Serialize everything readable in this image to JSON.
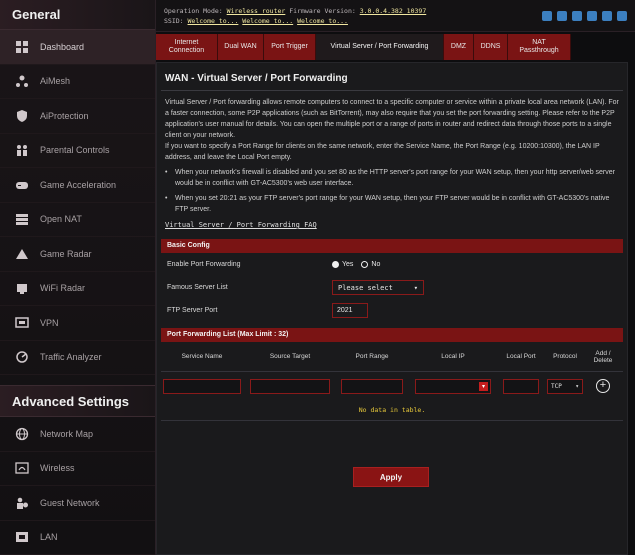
{
  "sidebar": {
    "general_heading": "General",
    "general_items": [
      {
        "label": "Dashboard",
        "icon": "dashboard-icon"
      },
      {
        "label": "AiMesh",
        "icon": "mesh-icon"
      },
      {
        "label": "AiProtection",
        "icon": "shield-icon"
      },
      {
        "label": "Parental Controls",
        "icon": "family-icon"
      },
      {
        "label": "Game Acceleration",
        "icon": "gamepad-icon"
      },
      {
        "label": "Open NAT",
        "icon": "nat-icon"
      },
      {
        "label": "Game Radar",
        "icon": "radar-icon"
      },
      {
        "label": "WiFi Radar",
        "icon": "wifi-radar-icon"
      },
      {
        "label": "VPN",
        "icon": "vpn-icon"
      },
      {
        "label": "Traffic Analyzer",
        "icon": "traffic-icon"
      }
    ],
    "advanced_heading": "Advanced Settings",
    "advanced_items": [
      {
        "label": "Network Map",
        "icon": "globe-icon"
      },
      {
        "label": "Wireless",
        "icon": "wireless-icon"
      },
      {
        "label": "Guest Network",
        "icon": "guest-icon"
      },
      {
        "label": "LAN",
        "icon": "lan-icon"
      }
    ]
  },
  "topbar": {
    "operation_mode_label": "Operation Mode:",
    "operation_mode_value": "Wireless router",
    "firmware_label": "Firmware Version:",
    "firmware_value": "3.0.0.4.382_10397",
    "ssid_label": "SSID:",
    "ssid_values": [
      "Welcome to...",
      "Welcome to...",
      "Welcome to..."
    ]
  },
  "tabs": [
    {
      "label": "Internet Connection",
      "active": false
    },
    {
      "label": "Dual WAN",
      "active": false
    },
    {
      "label": "Port Trigger",
      "active": false
    },
    {
      "label": "Virtual Server / Port Forwarding",
      "active": true
    },
    {
      "label": "DMZ",
      "active": false
    },
    {
      "label": "DDNS",
      "active": false
    },
    {
      "label": "NAT Passthrough",
      "active": false
    }
  ],
  "main": {
    "title": "WAN - Virtual Server / Port Forwarding",
    "description": "Virtual Server / Port forwarding allows remote computers to connect to a specific computer or service within a private local area network (LAN). For a faster connection, some P2P applications (such as BitTorrent), may also require that you set the port forwarding setting. Please refer to the P2P application's user manual for details. You can open the multiple port or a range of ports in router and redirect data through those ports to a single client on your network.",
    "description2": "If you want to specify a Port Range for clients on the same network, enter the Service Name, the Port Range (e.g. 10200:10300), the LAN IP address, and leave the Local Port empty.",
    "bullets": [
      "When your network's firewall is disabled and you set 80 as the HTTP server's port range for your WAN setup, then your http server/web server would be in conflict with GT-AC5300's web user interface.",
      "When you set 20:21 as your FTP server's port range for your WAN setup, then your FTP server would be in conflict with GT-AC5300's native FTP server."
    ],
    "faq_link": "Virtual Server / Port Forwarding FAQ",
    "basic_config": {
      "heading": "Basic Config",
      "enable_label": "Enable Port Forwarding",
      "yes_label": "Yes",
      "no_label": "No",
      "enabled": false,
      "famous_label": "Famous Server List",
      "famous_value": "Please select",
      "ftp_label": "FTP Server Port",
      "ftp_value": "2021"
    },
    "list": {
      "heading": "Port Forwarding List (Max Limit : 32)",
      "columns": [
        "Service Name",
        "Source Target",
        "Port Range",
        "Local IP",
        "Local Port",
        "Protocol",
        "Add / Delete"
      ],
      "protocol_value": "TCP",
      "no_data": "No data in table."
    },
    "apply_label": "Apply"
  },
  "colors": {
    "accent": "#7a1414",
    "background": "#1a1a1c",
    "no_data_text": "#e8c93a"
  }
}
